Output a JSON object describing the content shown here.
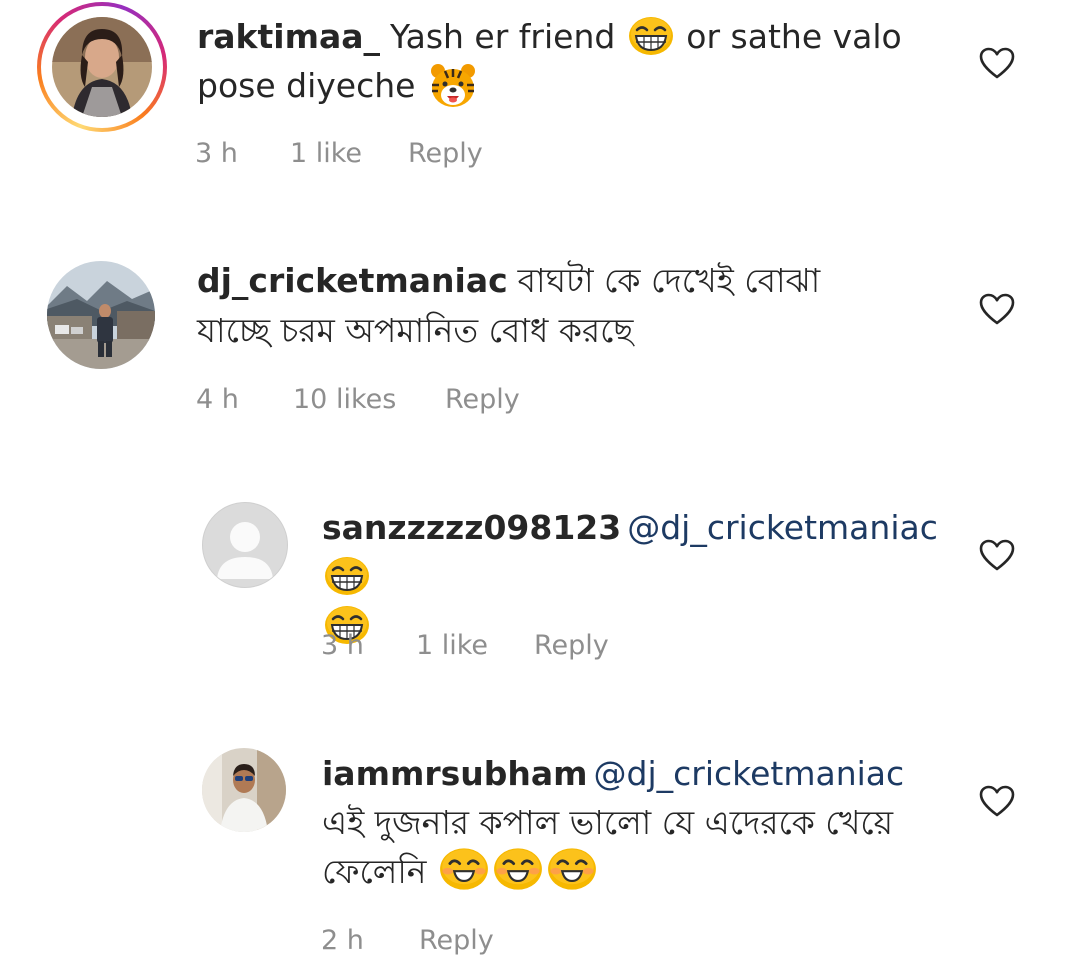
{
  "comments": [
    {
      "username": "raktimaa_",
      "text_parts": [
        "Yash er friend ",
        " or sathe valo pose diyeche "
      ],
      "emojis": [
        "grinning-squint-emoji",
        "tiger-face-emoji"
      ],
      "time": "3 h",
      "likes": "1 like",
      "reply": "Reply",
      "has_story_ring": true
    },
    {
      "username": "dj_cricketmaniac",
      "text": "বাঘটা কে দেখেই বোঝা যাচ্ছে চরম অপমানিত বোধ করছে",
      "time": "4 h",
      "likes": "10 likes",
      "reply": "Reply"
    },
    {
      "username": "sanzzzzz098123",
      "mention": "@dj_cricketmaniac",
      "emojis": [
        "grinning-squint-emoji",
        "grinning-squint-emoji"
      ],
      "time": "3 h",
      "likes": "1 like",
      "reply": "Reply",
      "default_avatar": true
    },
    {
      "username": "iammrsubham",
      "mention": "@dj_cricketmaniac",
      "text": "এই দুজনার কপাল ভালো যে এদেরকে খেয়ে ফেলেনি",
      "emojis": [
        "smiling-eyes-emoji",
        "smiling-eyes-emoji",
        "smiling-eyes-emoji"
      ],
      "time": "2 h",
      "reply": "Reply"
    }
  ],
  "colors": {
    "text": "#262626",
    "meta": "#8e8e8e",
    "mention": "#1d3a63"
  },
  "icons": {
    "like": "heart-outline-icon"
  }
}
